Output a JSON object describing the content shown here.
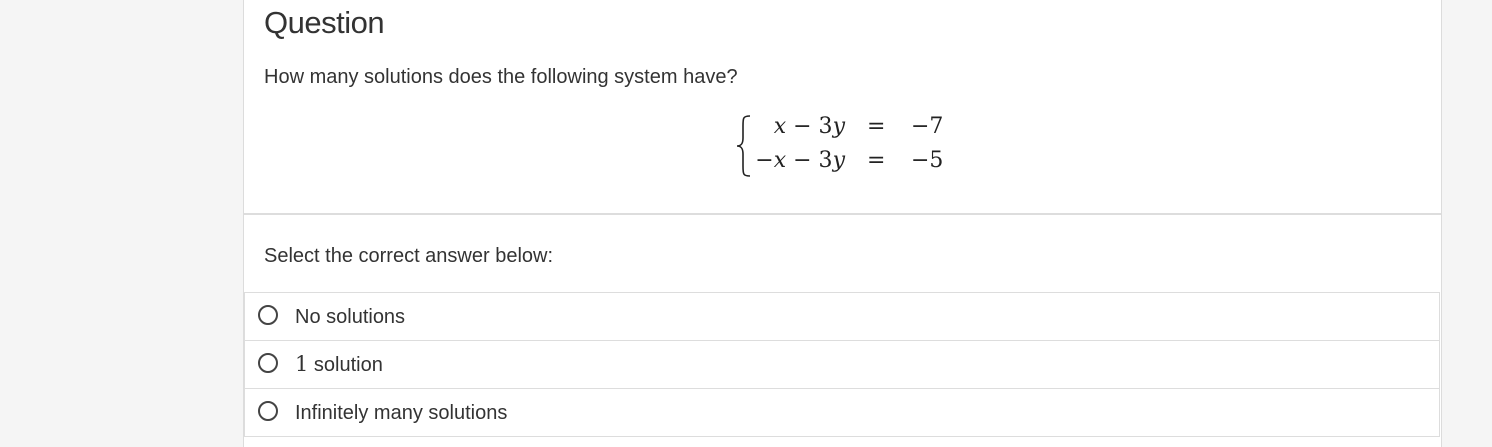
{
  "question": {
    "title": "Question",
    "prompt": "How many solutions does the following system have?",
    "system": [
      {
        "lhs_a": "x",
        "lhs_op": " − 3",
        "lhs_b": "y",
        "lhs_prefix": "",
        "sign": "=",
        "rhs": "−7"
      },
      {
        "lhs_a": "x",
        "lhs_op": " − 3",
        "lhs_b": "y",
        "lhs_prefix": "−",
        "sign": "=",
        "rhs": "−5"
      }
    ]
  },
  "answer": {
    "prompt": "Select the correct answer below:",
    "options": [
      {
        "number": "",
        "label": "No solutions",
        "selected": false
      },
      {
        "number": "1",
        "label": " solution",
        "selected": false
      },
      {
        "number": "",
        "label": "Infinitely many solutions",
        "selected": false
      }
    ]
  }
}
